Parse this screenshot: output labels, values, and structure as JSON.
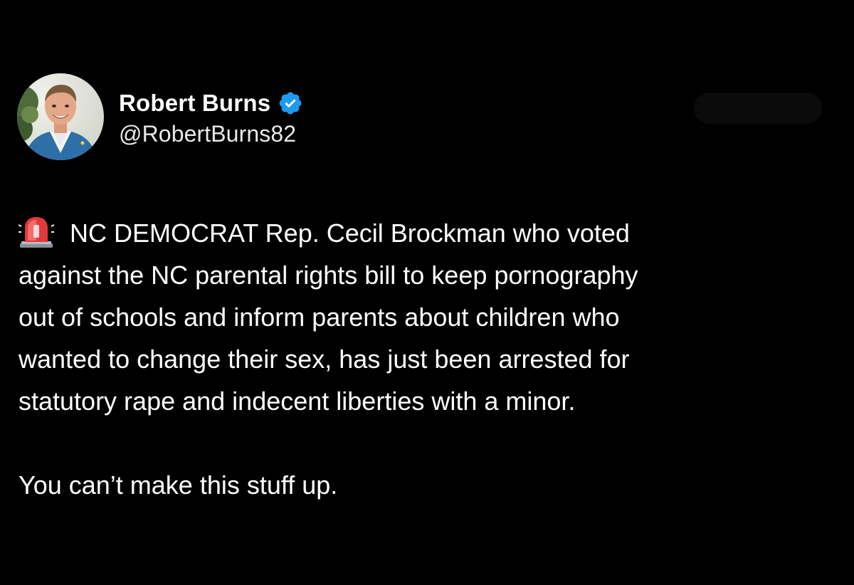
{
  "author": {
    "display_name": "Robert Burns",
    "handle": "@RobertBurns82",
    "verified": true
  },
  "tweet": {
    "lead_icon": "siren-emoji-icon",
    "lines": [
      "NC DEMOCRAT Rep. Cecil Brockman who voted",
      "against the NC parental rights bill to keep pornography",
      "out of schools and inform parents about children who",
      "wanted to change their sex, has just been arrested for",
      "statutory rape and indecent liberties with a minor."
    ],
    "closing": "You can’t make this stuff up."
  },
  "colors": {
    "background": "#000000",
    "text": "#ffffff",
    "verified_badge": "#1d9bf0"
  }
}
